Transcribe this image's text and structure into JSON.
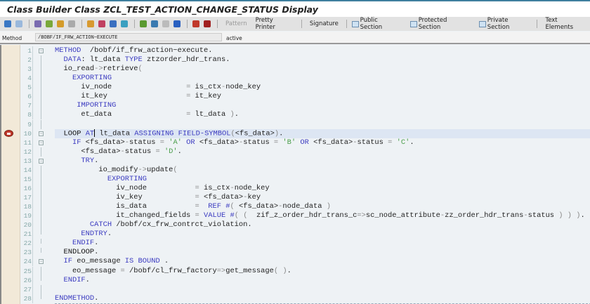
{
  "window": {
    "title": "Class Builder Class ZCL_TEST_ACTION_CHANGE_STATUS Display"
  },
  "toolbar": {
    "icons": [
      {
        "name": "back-icon",
        "color": "#3b78c4"
      },
      {
        "name": "forward-icon",
        "color": "#9ab8dc"
      },
      {
        "name": "display-change-icon",
        "color": "#7a6bb0"
      },
      {
        "name": "active-inactive-icon",
        "color": "#7aa83a"
      },
      {
        "name": "other-object-icon",
        "color": "#d49b2a"
      },
      {
        "name": "where-used-icon",
        "color": "#aaa"
      },
      {
        "name": "check-icon",
        "color": "#d89a30"
      },
      {
        "name": "activate-icon",
        "color": "#c04060"
      },
      {
        "name": "test-icon",
        "color": "#3a6fc0"
      },
      {
        "name": "navigation-icon",
        "color": "#3a9fc0"
      },
      {
        "name": "hierarchy-icon",
        "color": "#5a9a30"
      },
      {
        "name": "display-object-list-icon",
        "color": "#3a7ab0"
      },
      {
        "name": "fullscreen-icon",
        "color": "#bbb"
      },
      {
        "name": "info-icon",
        "color": "#2a60c0"
      },
      {
        "name": "breakpoint-icon",
        "color": "#c0392b"
      },
      {
        "name": "session-breakpoint-icon",
        "color": "#a02020"
      }
    ],
    "pattern": "Pattern",
    "pretty_printer": "Pretty Printer",
    "signature": "Signature",
    "public_section": "Public Section",
    "protected_section": "Protected Section",
    "private_section": "Private Section",
    "text_elements": "Text Elements"
  },
  "method_row": {
    "label": "Method",
    "value": "/BOBF/IF_FRW_ACTION~EXECUTE",
    "status": "active"
  },
  "editor": {
    "current_line": 10,
    "breakpoint_line": 10,
    "lines": [
      {
        "n": "1",
        "fold": "box",
        "seg": [
          [
            "kw",
            "METHOD"
          ],
          [
            "",
            "  /bobf/if_frw_action~execute."
          ]
        ]
      },
      {
        "n": "2",
        "fold": "line",
        "seg": [
          [
            "",
            "  "
          ],
          [
            "kw",
            "DATA"
          ],
          [
            "",
            ": lt_data "
          ],
          [
            "kw",
            "TYPE"
          ],
          [
            "",
            " ztzorder_hdr_trans."
          ]
        ]
      },
      {
        "n": "3",
        "fold": "line",
        "seg": [
          [
            "",
            "  io_read"
          ],
          [
            "op",
            "->"
          ],
          [
            "",
            "retrieve"
          ],
          [
            "op",
            "("
          ]
        ]
      },
      {
        "n": "4",
        "fold": "line",
        "seg": [
          [
            "",
            "    "
          ],
          [
            "kw",
            "EXPORTING"
          ]
        ]
      },
      {
        "n": "5",
        "fold": "line",
        "seg": [
          [
            "",
            "      iv_node                 "
          ],
          [
            "op",
            "="
          ],
          [
            "",
            " is_ctx"
          ],
          [
            "op",
            "-"
          ],
          [
            "",
            "node_key"
          ]
        ]
      },
      {
        "n": "6",
        "fold": "line",
        "seg": [
          [
            "",
            "      it_key                  "
          ],
          [
            "op",
            "="
          ],
          [
            "",
            " it_key"
          ]
        ]
      },
      {
        "n": "7",
        "fold": "line",
        "seg": [
          [
            "",
            "     "
          ],
          [
            "kw",
            "IMPORTING"
          ]
        ]
      },
      {
        "n": "8",
        "fold": "line",
        "seg": [
          [
            "",
            "      et_data                 "
          ],
          [
            "op",
            "="
          ],
          [
            "",
            " lt_data "
          ],
          [
            "op",
            ")"
          ],
          [
            "",
            "."
          ]
        ]
      },
      {
        "n": "9",
        "fold": "line",
        "seg": []
      },
      {
        "n": "10",
        "fold": "box",
        "seg": [
          [
            "",
            "  "
          ],
          [
            "kb",
            "LOOP"
          ],
          [
            "",
            " "
          ],
          [
            "kw",
            "AT"
          ],
          [
            "caret",
            ""
          ],
          [
            "",
            " lt_data "
          ],
          [
            "kw",
            "ASSIGNING FIELD-SYMBOL"
          ],
          [
            "op",
            "("
          ],
          [
            "",
            "<fs_data>"
          ],
          [
            "op",
            ")"
          ],
          [
            "",
            "."
          ]
        ]
      },
      {
        "n": "11",
        "fold": "box",
        "seg": [
          [
            "",
            "    "
          ],
          [
            "kw",
            "IF"
          ],
          [
            "",
            " <fs_data>"
          ],
          [
            "op",
            "-"
          ],
          [
            "",
            "status "
          ],
          [
            "op",
            "="
          ],
          [
            "",
            " "
          ],
          [
            "st",
            "'A'"
          ],
          [
            "",
            " "
          ],
          [
            "kw",
            "OR"
          ],
          [
            "",
            " <fs_data>"
          ],
          [
            "op",
            "-"
          ],
          [
            "",
            "status "
          ],
          [
            "op",
            "="
          ],
          [
            "",
            " "
          ],
          [
            "st",
            "'B'"
          ],
          [
            "",
            " "
          ],
          [
            "kw",
            "OR"
          ],
          [
            "",
            " <fs_data>"
          ],
          [
            "op",
            "-"
          ],
          [
            "",
            "status "
          ],
          [
            "op",
            "="
          ],
          [
            "",
            " "
          ],
          [
            "st",
            "'C'"
          ],
          [
            "",
            "."
          ]
        ]
      },
      {
        "n": "12",
        "fold": "line",
        "seg": [
          [
            "",
            "      <fs_data>"
          ],
          [
            "op",
            "-"
          ],
          [
            "",
            "status "
          ],
          [
            "op",
            "="
          ],
          [
            "",
            " "
          ],
          [
            "st",
            "'D'"
          ],
          [
            "",
            "."
          ]
        ]
      },
      {
        "n": "13",
        "fold": "box",
        "seg": [
          [
            "",
            "      "
          ],
          [
            "kw",
            "TRY"
          ],
          [
            "",
            "."
          ]
        ]
      },
      {
        "n": "14",
        "fold": "line",
        "seg": [
          [
            "",
            "          io_modify"
          ],
          [
            "op",
            "->"
          ],
          [
            "",
            "update"
          ],
          [
            "op",
            "("
          ]
        ]
      },
      {
        "n": "15",
        "fold": "line",
        "seg": [
          [
            "",
            "            "
          ],
          [
            "kw",
            "EXPORTING"
          ]
        ]
      },
      {
        "n": "16",
        "fold": "line",
        "seg": [
          [
            "",
            "              iv_node           "
          ],
          [
            "op",
            "="
          ],
          [
            "",
            " is_ctx"
          ],
          [
            "op",
            "-"
          ],
          [
            "",
            "node_key"
          ]
        ]
      },
      {
        "n": "17",
        "fold": "line",
        "seg": [
          [
            "",
            "              iv_key            "
          ],
          [
            "op",
            "="
          ],
          [
            "",
            " <fs_data>"
          ],
          [
            "op",
            "-"
          ],
          [
            "",
            "key"
          ]
        ]
      },
      {
        "n": "18",
        "fold": "line",
        "seg": [
          [
            "",
            "              is_data           "
          ],
          [
            "op",
            "="
          ],
          [
            "",
            "  "
          ],
          [
            "kw",
            "REF"
          ],
          [
            "",
            " "
          ],
          [
            "kw",
            "#"
          ],
          [
            "op",
            "("
          ],
          [
            "",
            " <fs_data>"
          ],
          [
            "op",
            "-"
          ],
          [
            "",
            "node_data "
          ],
          [
            "op",
            ")"
          ]
        ]
      },
      {
        "n": "19",
        "fold": "line",
        "seg": [
          [
            "",
            "              it_changed_fields "
          ],
          [
            "op",
            "="
          ],
          [
            "",
            " "
          ],
          [
            "kw",
            "VALUE"
          ],
          [
            "",
            " "
          ],
          [
            "kw",
            "#"
          ],
          [
            "op",
            "("
          ],
          [
            "",
            " "
          ],
          [
            "op",
            "("
          ],
          [
            "",
            "  zif_z_order_hdr_trans_c"
          ],
          [
            "op",
            "=>"
          ],
          [
            "",
            "sc_node_attribute"
          ],
          [
            "op",
            "-"
          ],
          [
            "",
            "zz_order_hdr_trans"
          ],
          [
            "op",
            "-"
          ],
          [
            "",
            "status "
          ],
          [
            "op",
            ")"
          ],
          [
            "",
            " "
          ],
          [
            "op",
            ")"
          ],
          [
            "",
            " "
          ],
          [
            "op",
            ")"
          ],
          [
            "",
            "."
          ]
        ]
      },
      {
        "n": "20",
        "fold": "dot",
        "seg": [
          [
            "",
            "        "
          ],
          [
            "kw",
            "CATCH"
          ],
          [
            "",
            " /bobf/cx_frw_contrct_violation."
          ]
        ]
      },
      {
        "n": "21",
        "fold": "end",
        "seg": [
          [
            "",
            "      "
          ],
          [
            "kw",
            "ENDTRY"
          ],
          [
            "",
            "."
          ]
        ]
      },
      {
        "n": "22",
        "fold": "end",
        "seg": [
          [
            "",
            "    "
          ],
          [
            "kw",
            "ENDIF"
          ],
          [
            "",
            "."
          ]
        ]
      },
      {
        "n": "23",
        "fold": "end",
        "seg": [
          [
            "",
            "  "
          ],
          [
            "kb",
            "ENDLOOP"
          ],
          [
            "",
            "."
          ]
        ]
      },
      {
        "n": "24",
        "fold": "box",
        "seg": [
          [
            "",
            "  "
          ],
          [
            "kw",
            "IF"
          ],
          [
            "",
            " eo_message "
          ],
          [
            "kw",
            "IS BOUND"
          ],
          [
            "",
            " ."
          ]
        ]
      },
      {
        "n": "25",
        "fold": "line",
        "seg": [
          [
            "",
            "    eo_message "
          ],
          [
            "op",
            "="
          ],
          [
            "",
            " /bobf/cl_frw_factory"
          ],
          [
            "op",
            "=>"
          ],
          [
            "",
            "get_message"
          ],
          [
            "op",
            "("
          ],
          [
            "",
            " "
          ],
          [
            "op",
            ")"
          ],
          [
            "",
            "."
          ]
        ]
      },
      {
        "n": "26",
        "fold": "end",
        "seg": [
          [
            "",
            "  "
          ],
          [
            "kw",
            "ENDIF"
          ],
          [
            "",
            "."
          ]
        ]
      },
      {
        "n": "27",
        "fold": "line",
        "seg": []
      },
      {
        "n": "28",
        "fold": "end",
        "seg": [
          [
            "kw",
            "ENDMETHOD"
          ],
          [
            "",
            "."
          ]
        ]
      }
    ]
  }
}
